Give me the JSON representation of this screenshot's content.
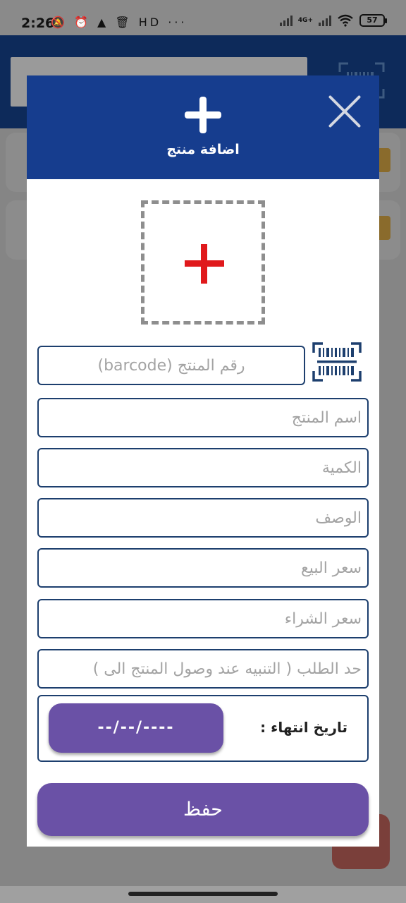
{
  "status_bar": {
    "time": "2:26",
    "left_icons": "🔕 ⏰ ▲ 🗑 HD ···",
    "network": "4G+",
    "battery": "57"
  },
  "dialog": {
    "title": "اضافة منتج",
    "fields": {
      "barcode_placeholder": "رقم المنتج (barcode)",
      "name_placeholder": "اسم المنتج",
      "quantity_placeholder": "الكمية",
      "description_placeholder": "الوصف",
      "sell_price_placeholder": "سعر البيع",
      "buy_price_placeholder": "سعر الشراء",
      "reorder_limit_placeholder": "حد الطلب ( التنبيه عند وصول المنتج الى )"
    },
    "expiry": {
      "label": "تاريخ انتهاء :",
      "date_value": "--/--/----"
    },
    "save_label": "حفظ"
  },
  "colors": {
    "header_blue": "#163d8e",
    "button_purple": "#6a51a6",
    "add_image_red": "#e0191c",
    "field_border": "#1d3f6e"
  },
  "icons": [
    "close-icon",
    "plus-icon",
    "add-image-icon",
    "barcode-scan-icon"
  ]
}
